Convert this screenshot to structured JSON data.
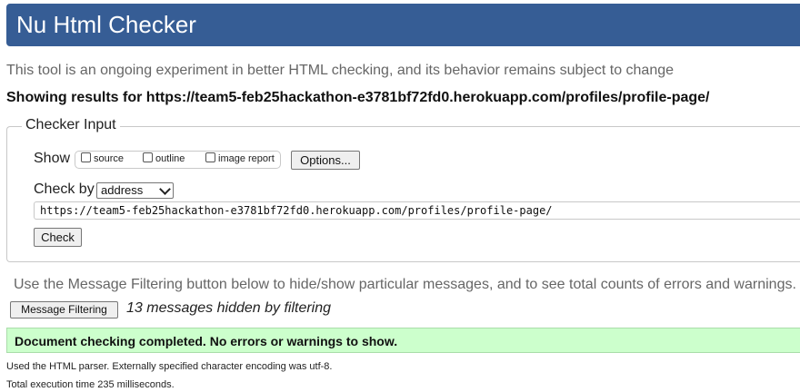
{
  "header": {
    "title": "Nu Html Checker"
  },
  "tagline": "This tool is an ongoing experiment in better HTML checking, and its behavior remains subject to change",
  "results_line": "Showing results for https://team5-feb25hackathon-e3781bf72fd0.herokuapp.com/profiles/profile-page/",
  "checker_input": {
    "legend": "Checker Input",
    "show_label": "Show",
    "show_options": [
      {
        "label": "source",
        "checked": false
      },
      {
        "label": "outline",
        "checked": false
      },
      {
        "label": "image report",
        "checked": false
      }
    ],
    "options_button": "Options...",
    "check_by_label": "Check by",
    "check_by_selected": "address",
    "url_value": "https://team5-feb25hackathon-e3781bf72fd0.herokuapp.com/profiles/profile-page/",
    "check_button": "Check"
  },
  "filtering": {
    "note": "Use the Message Filtering button below to hide/show particular messages, and to see total counts of errors and warnings.",
    "button": "Message Filtering",
    "hidden_count": "13 messages hidden by filtering"
  },
  "result": {
    "message": "Document checking completed. No errors or warnings to show."
  },
  "footer": {
    "parser_note": "Used the HTML parser. Externally specified character encoding was utf-8.",
    "exec_time": "Total execution time 235 milliseconds."
  },
  "colors": {
    "header_bg": "#365d95",
    "success_bg": "#ccffcc"
  }
}
